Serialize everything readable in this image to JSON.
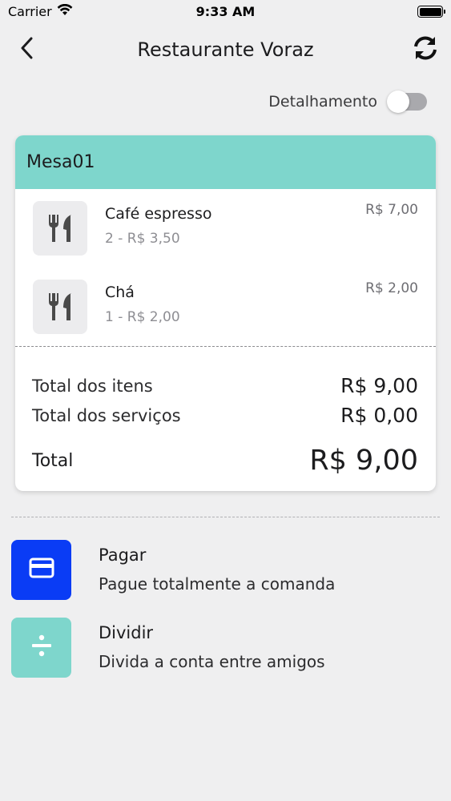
{
  "status_bar": {
    "carrier": "Carrier",
    "time": "9:33 AM"
  },
  "nav": {
    "title": "Restaurante Voraz",
    "icons": [
      "chevron-left-icon",
      "refresh-icon"
    ]
  },
  "toggle": {
    "label": "Detalhamento",
    "on": false
  },
  "order": {
    "table": "Mesa01",
    "items": [
      {
        "name": "Café espresso",
        "detail": "2 - R$ 3,50",
        "price": "R$ 7,00",
        "icon": "cutlery-icon"
      },
      {
        "name": "Chá",
        "detail": "1 - R$ 2,00",
        "price": "R$ 2,00",
        "icon": "cutlery-icon"
      }
    ],
    "totals": {
      "items_label": "Total dos itens",
      "items_value": "R$ 9,00",
      "services_label": "Total dos serviços",
      "services_value": "R$ 0,00",
      "grand_label": "Total",
      "grand_value": "R$ 9,00"
    }
  },
  "actions": [
    {
      "title": "Pagar",
      "subtitle": "Pague totalmente a comanda",
      "icon": "credit-card-icon",
      "color": "#0a3cf5"
    },
    {
      "title": "Dividir",
      "subtitle": "Divida a conta entre amigos",
      "icon": "divide-icon",
      "color": "#7ed6cc"
    }
  ],
  "colors": {
    "accent_teal": "#7ed6cc",
    "pay_blue": "#0a3cf5",
    "background": "#efeff0"
  }
}
